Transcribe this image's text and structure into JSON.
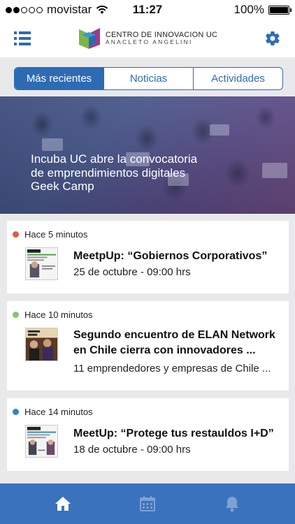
{
  "status_bar": {
    "carrier": "movistar",
    "time": "11:27",
    "battery": "100%",
    "battery_level": 1.0,
    "signal_bars_filled": 2,
    "signal_bars_total": 5
  },
  "header": {
    "logo_title": "CENTRO DE INNOVACION UC",
    "logo_subtitle": "ANACLETO ANGELINI",
    "menu_icon": "menu-icon",
    "settings_icon": "gear-icon"
  },
  "tabs": [
    {
      "label": "Más recientes",
      "active": true
    },
    {
      "label": "Noticias",
      "active": false
    },
    {
      "label": "Actividades",
      "active": false
    }
  ],
  "hero": {
    "title": "Incuba UC abre la convocatoria de emprendimientos digitales Geek Camp"
  },
  "feed": [
    {
      "time": "Hace 5 minutos",
      "dot_color": "#e05a44",
      "title": "MeetpUp: “Gobiernos Corporativos”",
      "subtitle": "25 de octubre - 09:00 hrs"
    },
    {
      "time": "Hace 10 minutos",
      "dot_color": "#8dbf78",
      "title": "Segundo encuentro de ELAN Network en Chile cierra con innovadores ...",
      "subtitle": "11 emprendedores y empresas de Chile ..."
    },
    {
      "time": "Hace 14 minutos",
      "dot_color": "#2d86c8",
      "title": "MeetUp: “Protege tus restauldos I+D”",
      "subtitle": "18 de octubre - 09:00 hrs"
    }
  ],
  "bottom_nav": [
    {
      "icon": "home-icon",
      "active": true
    },
    {
      "icon": "calendar-icon",
      "active": false
    },
    {
      "icon": "bell-icon",
      "active": false
    }
  ],
  "colors": {
    "accent": "#2d6bb5",
    "nav_background": "#3a72bd",
    "page_background": "#e9e9ec"
  }
}
